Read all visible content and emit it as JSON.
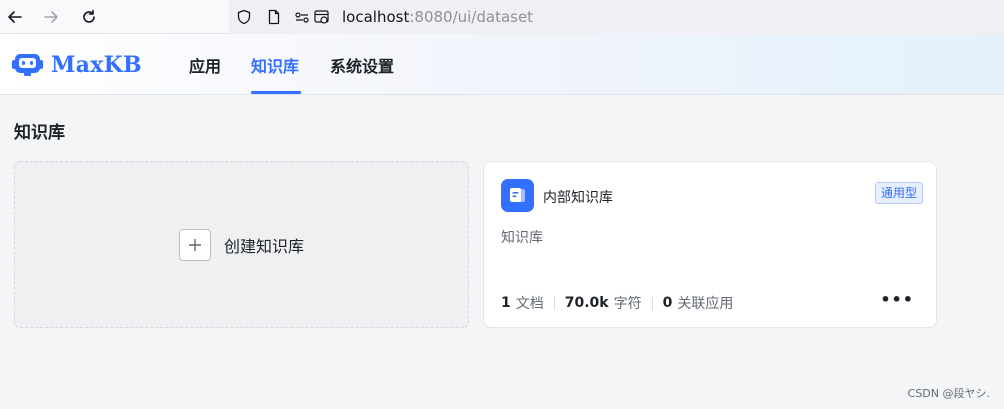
{
  "browser": {
    "url_host": "localhost",
    "url_path": ":8080/ui/dataset",
    "icons": [
      "back-arrow-icon",
      "forward-arrow-icon",
      "reload-icon",
      "shield-icon",
      "page-icon",
      "permissions-icon"
    ]
  },
  "header": {
    "logo_text": "MaxKB",
    "nav": [
      {
        "label": "应用",
        "active": false
      },
      {
        "label": "知识库",
        "active": true
      },
      {
        "label": "系统设置",
        "active": false
      }
    ]
  },
  "main": {
    "title": "知识库",
    "create_card": {
      "label": "创建知识库",
      "icon": "plus-icon"
    },
    "datasets": [
      {
        "name": "内部知识库",
        "type_badge": "通用型",
        "description": "知识库",
        "doc_count": "1",
        "doc_unit": "文档",
        "char_count": "70.0k",
        "char_unit": "字符",
        "app_count": "0",
        "app_unit": "关联应用",
        "more_label": "•••"
      }
    ]
  },
  "watermark": "CSDN @段ヤシ.",
  "colors": {
    "accent": "#3370ff",
    "background": "#f4f5f7"
  }
}
